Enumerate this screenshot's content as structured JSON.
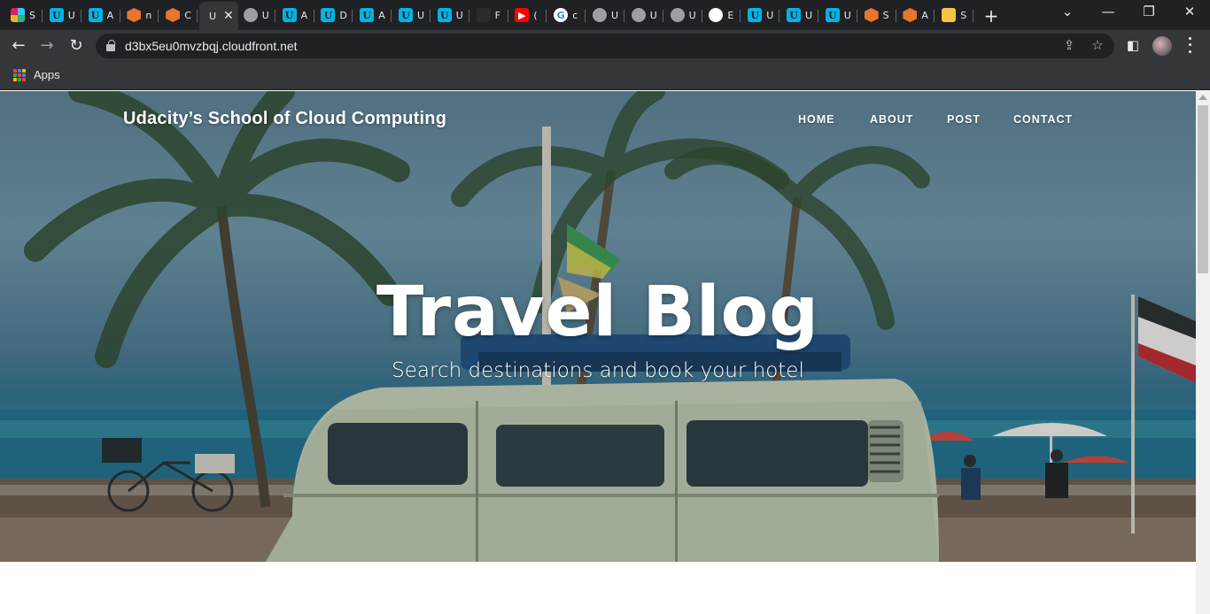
{
  "browser": {
    "tabs": [
      {
        "icon": "slack-icon",
        "letter": "",
        "label": "S"
      },
      {
        "icon": "udacity-icon",
        "letter": "U",
        "label": "U"
      },
      {
        "icon": "udacity-icon",
        "letter": "U",
        "label": "A"
      },
      {
        "icon": "aws-cube-icon",
        "letter": "",
        "label": "n"
      },
      {
        "icon": "aws-cube-icon",
        "letter": "",
        "label": "C"
      },
      {
        "icon": "active-tab",
        "letter": "",
        "label": "U"
      },
      {
        "icon": "globe-icon",
        "letter": "",
        "label": "U"
      },
      {
        "icon": "udacity-icon",
        "letter": "U",
        "label": "A"
      },
      {
        "icon": "udacity-icon",
        "letter": "U",
        "label": "D"
      },
      {
        "icon": "udacity-icon",
        "letter": "U",
        "label": "A"
      },
      {
        "icon": "udacity-icon",
        "letter": "U",
        "label": "U"
      },
      {
        "icon": "udacity-icon",
        "letter": "U",
        "label": "U"
      },
      {
        "icon": "dark-icon",
        "letter": "",
        "label": "F"
      },
      {
        "icon": "youtube-icon",
        "letter": "▶",
        "label": "("
      },
      {
        "icon": "google-icon",
        "letter": "G",
        "label": "c"
      },
      {
        "icon": "globe-icon",
        "letter": "",
        "label": "U"
      },
      {
        "icon": "globe-icon",
        "letter": "",
        "label": "U"
      },
      {
        "icon": "globe-icon",
        "letter": "",
        "label": "U"
      },
      {
        "icon": "github-icon",
        "letter": "",
        "label": "E"
      },
      {
        "icon": "udacity-icon",
        "letter": "U",
        "label": "U"
      },
      {
        "icon": "udacity-icon",
        "letter": "U",
        "label": "U"
      },
      {
        "icon": "udacity-icon",
        "letter": "U",
        "label": "U"
      },
      {
        "icon": "aws-cube-icon",
        "letter": "",
        "label": "S"
      },
      {
        "icon": "aws-cube-icon",
        "letter": "",
        "label": "A"
      },
      {
        "icon": "bag-icon",
        "letter": "",
        "label": "S"
      }
    ],
    "new_tab": "+",
    "url": "d3bx5eu0mvzbqj.cloudfront.net",
    "bookmarks": {
      "apps_label": "Apps"
    }
  },
  "site": {
    "brand": "Udacity’s School of Cloud Computing",
    "nav": [
      "HOME",
      "ABOUT",
      "POST",
      "CONTACT"
    ],
    "hero_title": "Travel Blog",
    "hero_subtitle": "Search destinations and book your hotel"
  },
  "colors": {
    "chrome_dark": "#202124",
    "chrome_toolbar": "#35363a",
    "udacity_blue": "#02b3e4",
    "aws_orange": "#e8772e"
  }
}
